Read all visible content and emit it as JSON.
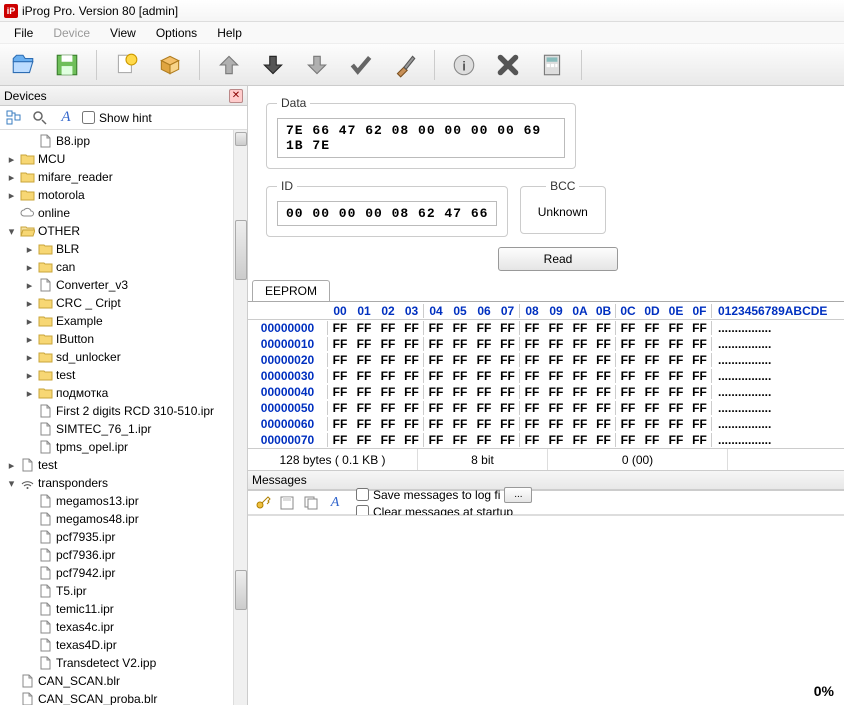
{
  "title": "iProg Pro. Version 80 [admin]",
  "menu": [
    "File",
    "Device",
    "View",
    "Options",
    "Help"
  ],
  "menu_disabled_index": 1,
  "devices_panel": {
    "title": "Devices",
    "show_hint": "Show hint"
  },
  "tree": [
    {
      "d": 1,
      "e": "",
      "i": "doc",
      "t": "B8.ipp"
    },
    {
      "d": 0,
      "e": ">",
      "i": "folder",
      "t": "MCU"
    },
    {
      "d": 0,
      "e": ">",
      "i": "folder",
      "t": "mifare_reader"
    },
    {
      "d": 0,
      "e": ">",
      "i": "folder",
      "t": "motorola"
    },
    {
      "d": 0,
      "e": "",
      "i": "cloud",
      "t": "online"
    },
    {
      "d": 0,
      "e": "v",
      "i": "folder-open",
      "t": "OTHER"
    },
    {
      "d": 1,
      "e": ">",
      "i": "folder",
      "t": "BLR"
    },
    {
      "d": 1,
      "e": ">",
      "i": "folder",
      "t": "can"
    },
    {
      "d": 1,
      "e": ">",
      "i": "doc",
      "t": "Converter_v3"
    },
    {
      "d": 1,
      "e": ">",
      "i": "folder",
      "t": "CRC _ Cript"
    },
    {
      "d": 1,
      "e": ">",
      "i": "folder",
      "t": "Example"
    },
    {
      "d": 1,
      "e": ">",
      "i": "folder",
      "t": "IButton"
    },
    {
      "d": 1,
      "e": ">",
      "i": "folder",
      "t": "sd_unlocker"
    },
    {
      "d": 1,
      "e": ">",
      "i": "folder",
      "t": "test"
    },
    {
      "d": 1,
      "e": ">",
      "i": "folder",
      "t": "подмотка"
    },
    {
      "d": 1,
      "e": "",
      "i": "doc",
      "t": "First 2 digits RCD 310-510.ipr"
    },
    {
      "d": 1,
      "e": "",
      "i": "doc",
      "t": "SIMTEC_76_1.ipr"
    },
    {
      "d": 1,
      "e": "",
      "i": "doc",
      "t": "tpms_opel.ipr"
    },
    {
      "d": 0,
      "e": ">",
      "i": "doc",
      "t": "test"
    },
    {
      "d": 0,
      "e": "v",
      "i": "wifi",
      "t": "transponders"
    },
    {
      "d": 1,
      "e": "",
      "i": "doc",
      "t": "megamos13.ipr"
    },
    {
      "d": 1,
      "e": "",
      "i": "doc",
      "t": "megamos48.ipr"
    },
    {
      "d": 1,
      "e": "",
      "i": "doc",
      "t": "pcf7935.ipr"
    },
    {
      "d": 1,
      "e": "",
      "i": "doc",
      "t": "pcf7936.ipr"
    },
    {
      "d": 1,
      "e": "",
      "i": "doc",
      "t": "pcf7942.ipr"
    },
    {
      "d": 1,
      "e": "",
      "i": "doc",
      "t": "T5.ipr"
    },
    {
      "d": 1,
      "e": "",
      "i": "doc",
      "t": "temic11.ipr"
    },
    {
      "d": 1,
      "e": "",
      "i": "doc",
      "t": "texas4c.ipr"
    },
    {
      "d": 1,
      "e": "",
      "i": "doc",
      "t": "texas4D.ipr"
    },
    {
      "d": 1,
      "e": "",
      "i": "doc",
      "t": "Transdetect V2.ipp"
    },
    {
      "d": 0,
      "e": "",
      "i": "doc",
      "t": "CAN_SCAN.blr"
    },
    {
      "d": 0,
      "e": "",
      "i": "doc",
      "t": "CAN_SCAN_proba.blr"
    }
  ],
  "fields": {
    "data_label": "Data",
    "data_value": "7E 66 47 62 08 00 00 00 00 69 1B 7E",
    "id_label": "ID",
    "id_value": "00 00 00 00 08 62 47 66",
    "bcc_label": "BCC",
    "bcc_value": "Unknown",
    "read_btn": "Read"
  },
  "eeprom": {
    "tab": "EEPROM",
    "cols": [
      "00",
      "01",
      "02",
      "03",
      "04",
      "05",
      "06",
      "07",
      "08",
      "09",
      "0A",
      "0B",
      "0C",
      "0D",
      "0E",
      "0F"
    ],
    "ascii_hdr": "0123456789ABCDE",
    "rows": [
      {
        "a": "00000000",
        "v": "FF",
        "s": "................"
      },
      {
        "a": "00000010",
        "v": "FF",
        "s": "................"
      },
      {
        "a": "00000020",
        "v": "FF",
        "s": "................"
      },
      {
        "a": "00000030",
        "v": "FF",
        "s": "................"
      },
      {
        "a": "00000040",
        "v": "FF",
        "s": "................"
      },
      {
        "a": "00000050",
        "v": "FF",
        "s": "................"
      },
      {
        "a": "00000060",
        "v": "FF",
        "s": "................"
      },
      {
        "a": "00000070",
        "v": "FF",
        "s": "................"
      }
    ],
    "status": {
      "size": "128 bytes ( 0.1 KB )",
      "bits": "8 bit",
      "pos": "0 (00)"
    }
  },
  "messages": {
    "title": "Messages",
    "save": "Save messages to log fi",
    "clear": "Clear messages at startup",
    "btn": "..."
  },
  "percent": "0%"
}
